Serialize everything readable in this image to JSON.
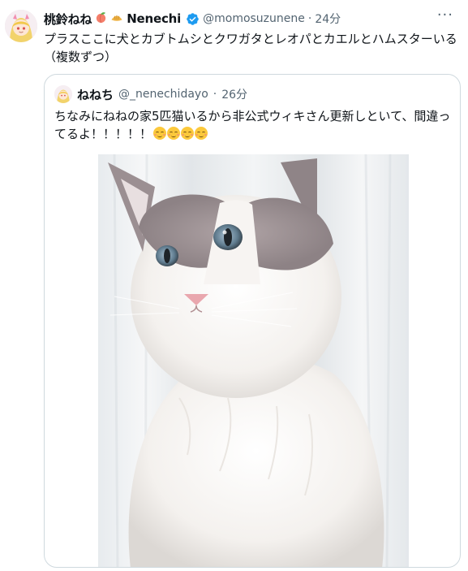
{
  "tweet": {
    "display_name": "桃鈴ねね",
    "name_suffix": "Nenechi",
    "name_emojis": [
      "peach-emoji",
      "bread-emoji"
    ],
    "handle": "@momosuzunene",
    "separator": "·",
    "time": "24分",
    "more_label": "···",
    "text": "プラスここに犬とカブトムシとクワガタとレオパとカエルとハムスターいる（複数ずつ）"
  },
  "quote": {
    "display_name": "ねねち",
    "handle": "@_nenechidayo",
    "separator": "·",
    "time": "26分",
    "text": "ちなみにねねの家5匹猫いるから非公式ウィキさん更新しといて、間違ってるよ！！！！！",
    "emoji_count": 4
  },
  "colors": {
    "text_primary": "#0f1419",
    "text_secondary": "#536471",
    "border": "#cfd9de",
    "verified_blue": "#1d9bf0"
  }
}
